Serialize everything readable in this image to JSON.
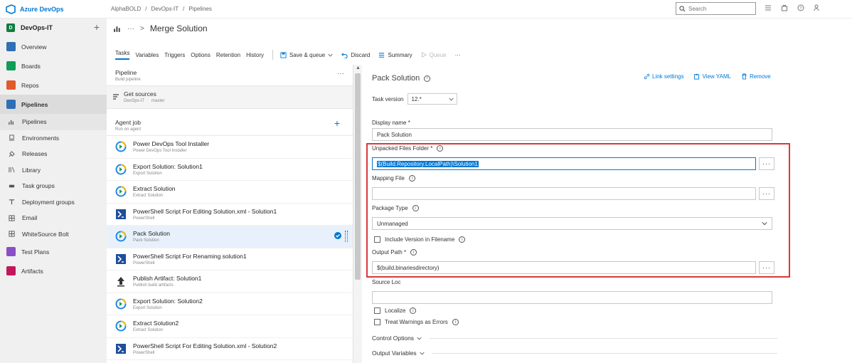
{
  "topbar": {
    "product": "Azure DevOps",
    "breadcrumbs": [
      "AlphaBOLD",
      "/",
      "DevOps-IT",
      "/",
      "Pipelines"
    ],
    "search_placeholder": "Search"
  },
  "sidebar": {
    "org_initial": "D",
    "org_name": "DevOps-IT",
    "items": [
      {
        "label": "Overview",
        "color": "#2f6fb5"
      },
      {
        "label": "Boards",
        "color": "#0f9d58"
      },
      {
        "label": "Repos",
        "color": "#e05a2b"
      },
      {
        "label": "Pipelines",
        "color": "#2f6fb5"
      }
    ],
    "subitems": [
      "Pipelines",
      "Environments",
      "Releases",
      "Library",
      "Task groups",
      "Deployment groups",
      "Email",
      "WhiteSource Bolt"
    ],
    "bottom_items": [
      {
        "label": "Test Plans",
        "color": "#8a4fc5"
      },
      {
        "label": "Artifacts",
        "color": "#c2185b"
      }
    ]
  },
  "header": {
    "ellipsis": "···",
    "chevron": ">",
    "title": "Merge Solution"
  },
  "toolbar": {
    "tabs": [
      "Tasks",
      "Variables",
      "Triggers",
      "Options",
      "Retention",
      "History"
    ],
    "save_queue": "Save & queue",
    "discard": "Discard",
    "summary": "Summary",
    "queue": "Queue",
    "more": "···"
  },
  "tasklist": {
    "pipeline_title": "Pipeline",
    "pipeline_sub": "Build pipeline",
    "pipeline_more": "···",
    "getsrc_title": "Get sources",
    "getsrc_repo": "DevOps-IT",
    "getsrc_branch": "master",
    "agent_title": "Agent job",
    "agent_sub": "Run on agent",
    "tasks": [
      {
        "title": "Power DevOps Tool Installer",
        "sub": "Power DevOps Tool Installer",
        "icon": "power-devops"
      },
      {
        "title": "Export Solution: Solution1",
        "sub": "Export Solution",
        "icon": "power-devops"
      },
      {
        "title": "Extract Solution",
        "sub": "Extract Solution",
        "icon": "power-devops"
      },
      {
        "title": "PowerShell Script For Editing Solution.xml - Solution1",
        "sub": "PowerShell",
        "icon": "powershell"
      },
      {
        "title": "Pack Solution",
        "sub": "Pack Solution",
        "icon": "power-devops"
      },
      {
        "title": "PowerShell Script For Renaming solution1",
        "sub": "PowerShell",
        "icon": "powershell"
      },
      {
        "title": "Publish Artifact: Solution1",
        "sub": "Publish build artifacts",
        "icon": "upload"
      },
      {
        "title": "Export Solution: Solution2",
        "sub": "Export Solution",
        "icon": "power-devops"
      },
      {
        "title": "Extract Solution2",
        "sub": "Extract Solution",
        "icon": "power-devops"
      },
      {
        "title": "PowerShell Script For Editing Solution.xml - Solution2",
        "sub": "PowerShell",
        "icon": "powershell"
      }
    ]
  },
  "details": {
    "title": "Pack Solution",
    "link_settings": "Link settings",
    "view_yaml": "View YAML",
    "remove": "Remove",
    "task_version_label": "Task version",
    "task_version": "12.*",
    "display_name_label": "Display name *",
    "display_name": "Pack Solution",
    "unpacked_label": "Unpacked Files Folder *",
    "unpacked_value": "$(Build.Repository.LocalPath)\\Solution1",
    "mapping_label": "Mapping File",
    "mapping_value": "",
    "package_type_label": "Package Type",
    "package_type": "Unmanaged",
    "include_version_label": "Include Version in Filename",
    "output_path_label": "Output Path *",
    "output_path": "$(build.binariesdirectory)",
    "source_loc_label": "Source Loc",
    "source_loc": "",
    "localize_label": "Localize",
    "treat_warnings_label": "Treat Warnings as Errors",
    "control_options": "Control Options",
    "output_variables": "Output Variables",
    "dots": "···"
  },
  "colors": {
    "accent": "#0078d4",
    "highlight_border": "#d9393c"
  }
}
